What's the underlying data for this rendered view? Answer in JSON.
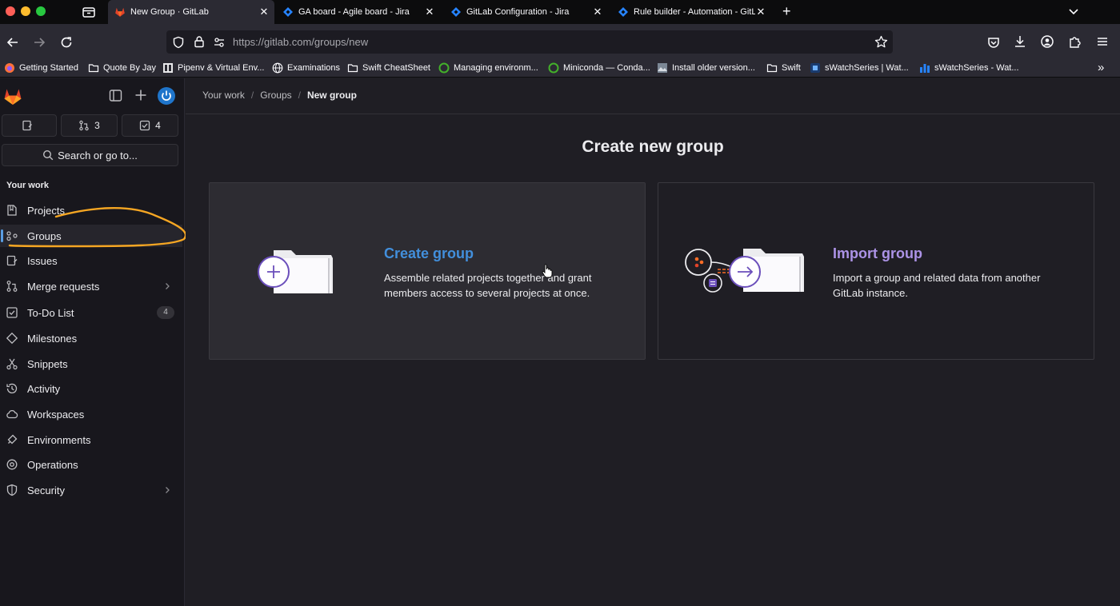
{
  "browser": {
    "tabs": [
      {
        "title": "New Group · GitLab",
        "active": true,
        "icon": "gitlab-icon"
      },
      {
        "title": "GA board - Agile board - Jira",
        "active": false,
        "icon": "jira-icon"
      },
      {
        "title": "GitLab Configuration - Jira",
        "active": false,
        "icon": "jira-icon"
      },
      {
        "title": "Rule builder - Automation - GitLab",
        "active": false,
        "icon": "jira-icon"
      }
    ],
    "url": "https://gitlab.com/groups/new",
    "bookmarks": [
      {
        "label": "Getting Started",
        "icon": "firefox-icon"
      },
      {
        "label": "Quote By Jay",
        "icon": "folder-icon"
      },
      {
        "label": "Pipenv & Virtual Env...",
        "icon": "book-icon"
      },
      {
        "label": "Examinations",
        "icon": "globe-icon"
      },
      {
        "label": "Swift CheatSheet",
        "icon": "folder-icon"
      },
      {
        "label": "Managing environm...",
        "icon": "conda-icon"
      },
      {
        "label": "Miniconda — Conda...",
        "icon": "conda-icon"
      },
      {
        "label": "Install older version...",
        "icon": "image-icon"
      },
      {
        "label": "Swift",
        "icon": "folder-icon"
      },
      {
        "label": "sWatchSeries | Wat...",
        "icon": "stream-icon"
      },
      {
        "label": "sWatchSeries - Wat...",
        "icon": "chart-icon"
      }
    ],
    "colors": {
      "chrome_dark": "#0c0c0d",
      "chrome": "#2b2a33",
      "url_bg": "#1c1b22"
    }
  },
  "sidebar": {
    "counters": [
      {
        "icon": "issue-icon",
        "count": ""
      },
      {
        "icon": "merge-request-icon",
        "count": "3"
      },
      {
        "icon": "todo-icon",
        "count": "4"
      }
    ],
    "search_label": "Search or go to...",
    "section_title": "Your work",
    "items": [
      {
        "label": "Projects",
        "icon": "project-icon",
        "badge": "",
        "chevron": false,
        "active": false
      },
      {
        "label": "Groups",
        "icon": "group-icon",
        "badge": "",
        "chevron": false,
        "active": true
      },
      {
        "label": "Issues",
        "icon": "issues-icon",
        "badge": "",
        "chevron": false,
        "active": false
      },
      {
        "label": "Merge requests",
        "icon": "merge-request-icon",
        "badge": "",
        "chevron": true,
        "active": false
      },
      {
        "label": "To-Do List",
        "icon": "todo-icon",
        "badge": "4",
        "chevron": false,
        "active": false
      },
      {
        "label": "Milestones",
        "icon": "milestone-icon",
        "badge": "",
        "chevron": false,
        "active": false
      },
      {
        "label": "Snippets",
        "icon": "snippet-icon",
        "badge": "",
        "chevron": false,
        "active": false
      },
      {
        "label": "Activity",
        "icon": "history-icon",
        "badge": "",
        "chevron": false,
        "active": false
      },
      {
        "label": "Workspaces",
        "icon": "cloud-icon",
        "badge": "",
        "chevron": false,
        "active": false
      },
      {
        "label": "Environments",
        "icon": "environment-icon",
        "badge": "",
        "chevron": false,
        "active": false
      },
      {
        "label": "Operations",
        "icon": "monitor-icon",
        "badge": "",
        "chevron": false,
        "active": false
      },
      {
        "label": "Security",
        "icon": "shield-icon",
        "badge": "",
        "chevron": true,
        "active": false
      }
    ],
    "annotation_color": "#f5a623"
  },
  "breadcrumb": [
    "Your work",
    "Groups",
    "New group"
  ],
  "page_title": "Create new group",
  "cards": {
    "create": {
      "title": "Create group",
      "description": "Assemble related projects together and grant members access to several projects at once.",
      "title_color": "#428fdc"
    },
    "import": {
      "title": "Import group",
      "description": "Import a group and related data from another GitLab instance.",
      "title_color": "#ac93e6"
    }
  }
}
